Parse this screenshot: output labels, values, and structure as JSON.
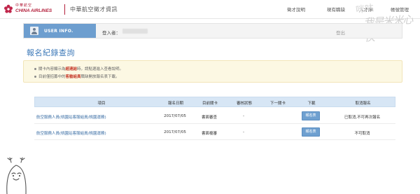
{
  "header": {
    "logo_zh": "中華航空",
    "logo_en": "CHINA AIRLINES",
    "site_title": "中華航空徵才資訊",
    "nav": [
      "徵才說明",
      "現有職缺",
      "人才庫",
      "帳號管理"
    ]
  },
  "watermark": {
    "line1": "咪咕",
    "line2": "我是米米心侠"
  },
  "userbar": {
    "tag_label": "USER INFO.",
    "login_label": "登入者：",
    "logout_label": "登出"
  },
  "page_title": "報名紀錄查詢",
  "notice": {
    "line1": {
      "before": "關卡內容顯示為",
      "em": "超連結",
      "after": "時，請點選進入查看說明。"
    },
    "line2": {
      "before": "目前僅招募中的",
      "em": "客艙組員",
      "after": "職缺開放報名表下載。"
    }
  },
  "table": {
    "headers": [
      "項目",
      "報名日期",
      "目前關卡",
      "審核狀態",
      "下一關卡",
      "下載",
      "取消報名"
    ],
    "rows": [
      {
        "item": "航空服務人員(桃園站客服組員/桃園運務)",
        "date": "2017/07/05",
        "stage": "書面審查",
        "status": "-",
        "next": "",
        "download": "報名表",
        "cancel": "已取消,不可再次報名"
      },
      {
        "item": "航空服務人員(桃園站客服組員/桃園運務)",
        "date": "2017/07/05",
        "stage": "書面複審",
        "status": "-",
        "next": "",
        "download": "報名表",
        "cancel": "不可取消"
      }
    ]
  },
  "colors": {
    "brand": "#b3203c",
    "accent": "#3e7ab9",
    "tag": "#6d9ecf",
    "notice_bg": "#fcf8e3",
    "table_head": "#d7e6f5"
  }
}
